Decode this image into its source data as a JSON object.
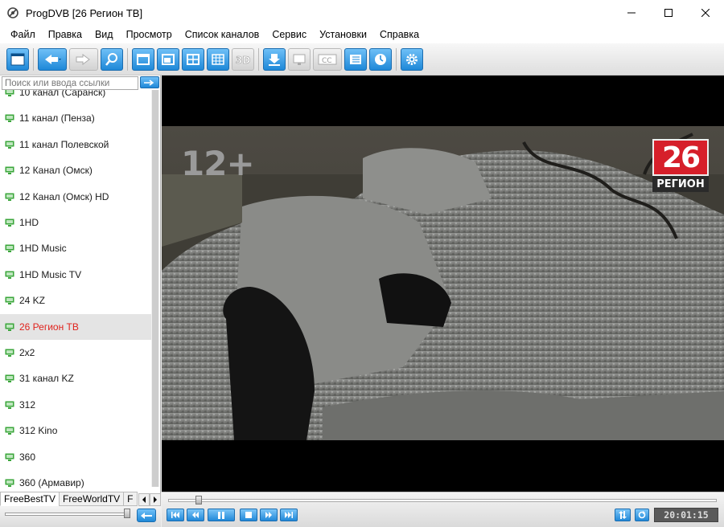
{
  "window": {
    "title": "ProgDVB [26 Регион ТВ]",
    "app_icon": "progdvb-logo-icon",
    "controls": [
      "minimize-icon",
      "maximize-icon",
      "close-icon"
    ]
  },
  "menu": [
    "Файл",
    "Правка",
    "Вид",
    "Просмотр",
    "Список каналов",
    "Сервис",
    "Установки",
    "Справка"
  ],
  "toolbar": {
    "buttons": [
      {
        "icon": "channel-list-icon",
        "enabled": true
      },
      {
        "icon": "back-icon",
        "enabled": true
      },
      {
        "icon": "forward-icon",
        "enabled": false
      },
      {
        "icon": "zoom-icon",
        "enabled": true
      },
      {
        "icon": "single-view-icon",
        "enabled": true
      },
      {
        "icon": "window-view-icon",
        "enabled": true
      },
      {
        "icon": "quad-view-icon",
        "enabled": true
      },
      {
        "icon": "grid-view-icon",
        "enabled": true
      },
      {
        "icon": "3d-icon",
        "label": "3D",
        "enabled": false
      },
      {
        "icon": "record-download-icon",
        "enabled": true
      },
      {
        "icon": "teletext-icon",
        "enabled": false
      },
      {
        "icon": "subtitles-icon",
        "label": "CC",
        "enabled": false
      },
      {
        "icon": "epg-list-icon",
        "enabled": true
      },
      {
        "icon": "scheduler-clock-icon",
        "enabled": true
      },
      {
        "icon": "settings-gear-icon",
        "enabled": true
      }
    ]
  },
  "search": {
    "placeholder": "Поиск или ввода ссылки",
    "value": ""
  },
  "channels": [
    {
      "name": "10 канал (Саранск)",
      "selected": false
    },
    {
      "name": "11 канал (Пенза)",
      "selected": false
    },
    {
      "name": "11 канал Полевской",
      "selected": false
    },
    {
      "name": "12 Канал (Омск)",
      "selected": false
    },
    {
      "name": "12 Канал (Омск) HD",
      "selected": false
    },
    {
      "name": "1HD",
      "selected": false
    },
    {
      "name": "1HD Music",
      "selected": false
    },
    {
      "name": "1HD Music TV",
      "selected": false
    },
    {
      "name": "24 KZ",
      "selected": false
    },
    {
      "name": "26 Регион ТВ",
      "selected": true
    },
    {
      "name": "2x2",
      "selected": false
    },
    {
      "name": "31 канал KZ",
      "selected": false
    },
    {
      "name": "312",
      "selected": false
    },
    {
      "name": "312 Kino",
      "selected": false
    },
    {
      "name": "360",
      "selected": false
    },
    {
      "name": "360 (Армавир)",
      "selected": false
    }
  ],
  "tabs": [
    {
      "label": "FreeBestTV",
      "active": true
    },
    {
      "label": "FreeWorldTV",
      "active": false
    },
    {
      "label": "F",
      "active": false
    }
  ],
  "video": {
    "age_rating": "12+",
    "channel_logo_number": "26",
    "channel_logo_word": "РЕГИОН"
  },
  "playback": {
    "seek_fraction": 0.05,
    "volume_fraction": 1.0,
    "time": "20:01:15",
    "buttons": [
      "skip-start-icon",
      "rewind-icon",
      "pause-icon",
      "stop-icon",
      "fast-forward-icon",
      "skip-end-icon"
    ]
  },
  "colors": {
    "accent": "#1e88d8",
    "selected_channel_text": "#e0231d",
    "channel_icon": "#3aa63a"
  }
}
